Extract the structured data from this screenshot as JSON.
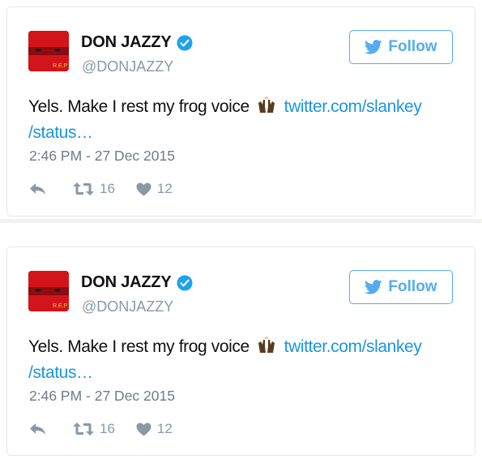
{
  "tweets": [
    {
      "author_name": "DON JAZZY",
      "handle": "@DONJAZZY",
      "follow_label": "Follow",
      "text": "Yels. Make I rest my frog voice",
      "link_line1": "twitter.com/slankey",
      "link_line2": "/status…",
      "timestamp": "2:46 PM - 27 Dec 2015",
      "retweets": "16",
      "likes": "12",
      "avatar_text": "R.E.P"
    },
    {
      "author_name": "DON JAZZY",
      "handle": "@DONJAZZY",
      "follow_label": "Follow",
      "text": "Yels. Make I rest my frog voice",
      "link_line1": "twitter.com/slankey",
      "link_line2": "/status…",
      "timestamp": "2:46 PM - 27 Dec 2015",
      "retweets": "16",
      "likes": "12",
      "avatar_text": "R.E.P"
    }
  ],
  "colors": {
    "accent": "#55acee",
    "link": "#1b95e0",
    "muted": "#8899a6",
    "avatar_red": "#d4141b"
  },
  "icons": [
    "verified-badge-icon",
    "twitter-bird-icon",
    "raised-hands-emoji-icon",
    "reply-icon",
    "retweet-icon",
    "heart-icon"
  ]
}
